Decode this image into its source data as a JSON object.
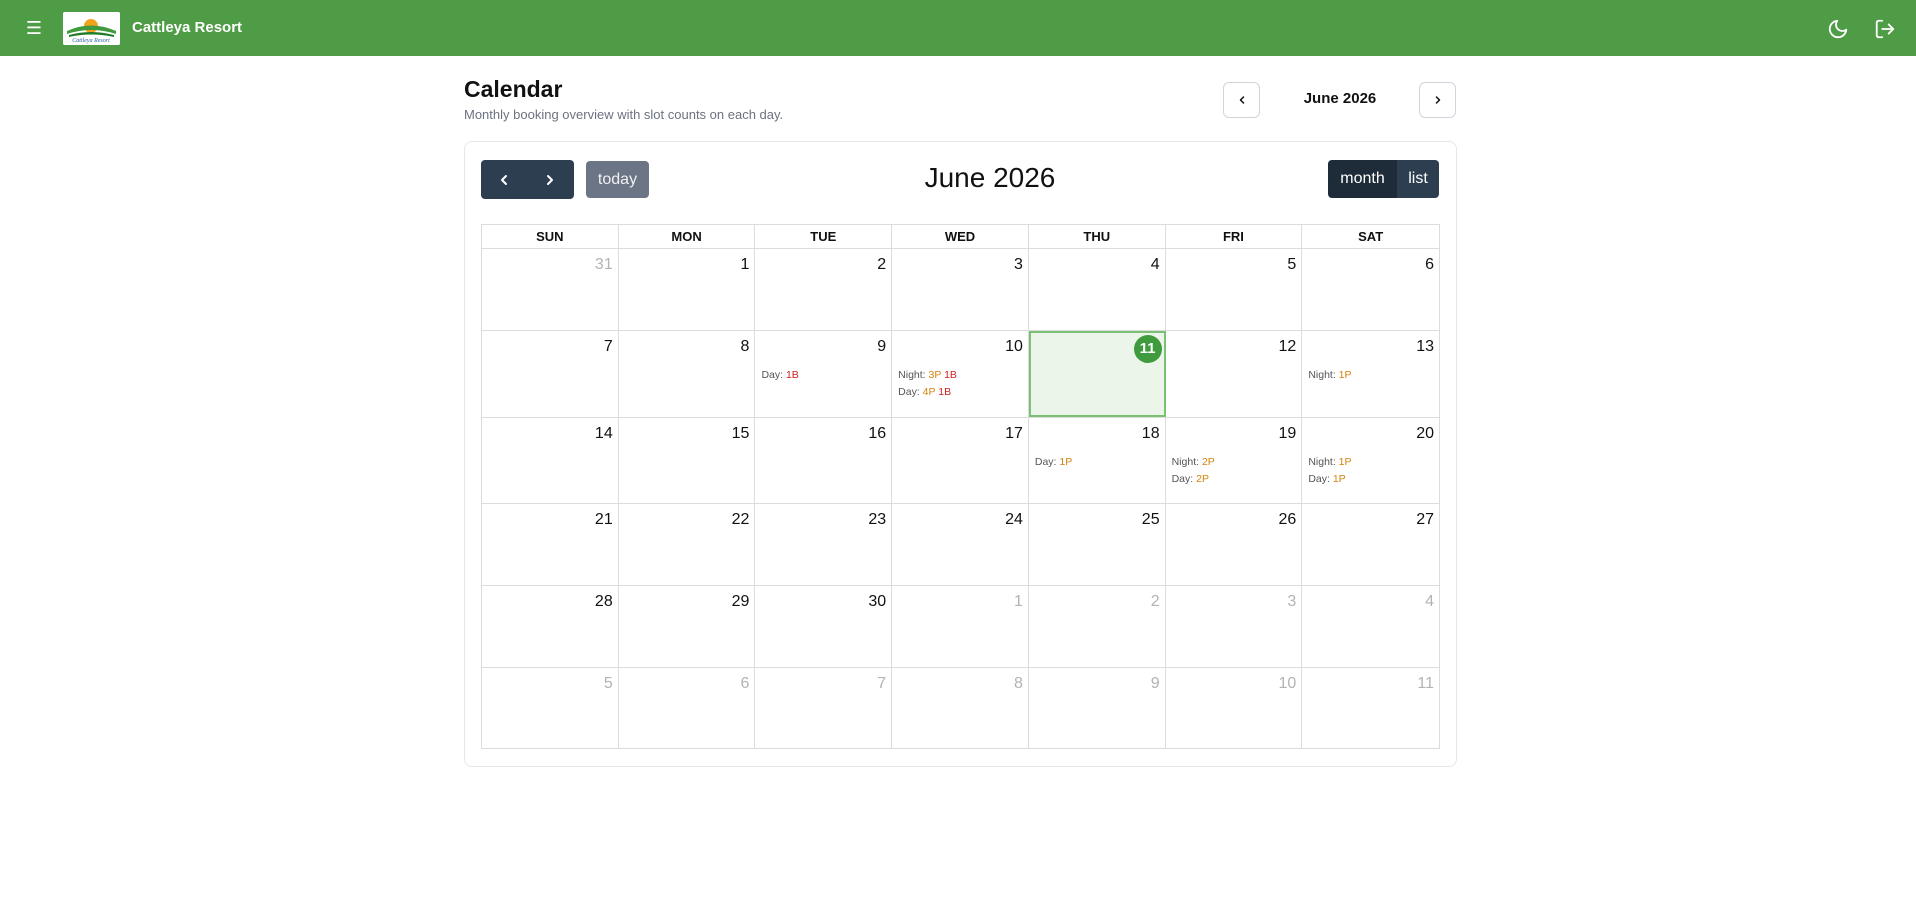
{
  "app": {
    "brand": "Cattleya Resort"
  },
  "header": {
    "title": "Calendar",
    "subtitle": "Monthly booking overview with slot counts on each day.",
    "month_label": "June 2026"
  },
  "calendar": {
    "title": "June 2026",
    "today_label": "today",
    "view_month_label": "month",
    "view_list_label": "list",
    "weekdays": [
      "SUN",
      "MON",
      "TUE",
      "WED",
      "THU",
      "FRI",
      "SAT"
    ],
    "weeks": [
      [
        {
          "num": "31",
          "other": true
        },
        {
          "num": "1"
        },
        {
          "num": "2"
        },
        {
          "num": "3"
        },
        {
          "num": "4"
        },
        {
          "num": "5"
        },
        {
          "num": "6"
        }
      ],
      [
        {
          "num": "7"
        },
        {
          "num": "8"
        },
        {
          "num": "9",
          "slots": [
            {
              "label": "Day:",
              "tags": [
                {
                  "text": "1B",
                  "kind": "b"
                }
              ]
            }
          ]
        },
        {
          "num": "10",
          "slots": [
            {
              "label": "Night:",
              "tags": [
                {
                  "text": "3P",
                  "kind": "p"
                },
                {
                  "text": "1B",
                  "kind": "b"
                }
              ]
            },
            {
              "label": "Day:",
              "tags": [
                {
                  "text": "4P",
                  "kind": "p"
                },
                {
                  "text": "1B",
                  "kind": "b"
                }
              ]
            }
          ]
        },
        {
          "num": "11",
          "today": true
        },
        {
          "num": "12"
        },
        {
          "num": "13",
          "slots": [
            {
              "label": "Night:",
              "tags": [
                {
                  "text": "1P",
                  "kind": "p"
                }
              ]
            }
          ]
        }
      ],
      [
        {
          "num": "14"
        },
        {
          "num": "15"
        },
        {
          "num": "16"
        },
        {
          "num": "17"
        },
        {
          "num": "18",
          "slots": [
            {
              "label": "Day:",
              "tags": [
                {
                  "text": "1P",
                  "kind": "p"
                }
              ]
            }
          ]
        },
        {
          "num": "19",
          "slots": [
            {
              "label": "Night:",
              "tags": [
                {
                  "text": "2P",
                  "kind": "p"
                }
              ]
            },
            {
              "label": "Day:",
              "tags": [
                {
                  "text": "2P",
                  "kind": "p"
                }
              ]
            }
          ]
        },
        {
          "num": "20",
          "slots": [
            {
              "label": "Night:",
              "tags": [
                {
                  "text": "1P",
                  "kind": "p"
                }
              ]
            },
            {
              "label": "Day:",
              "tags": [
                {
                  "text": "1P",
                  "kind": "p"
                }
              ]
            }
          ]
        }
      ],
      [
        {
          "num": "21"
        },
        {
          "num": "22"
        },
        {
          "num": "23"
        },
        {
          "num": "24"
        },
        {
          "num": "25"
        },
        {
          "num": "26"
        },
        {
          "num": "27"
        }
      ],
      [
        {
          "num": "28"
        },
        {
          "num": "29"
        },
        {
          "num": "30"
        },
        {
          "num": "1",
          "other": true
        },
        {
          "num": "2",
          "other": true
        },
        {
          "num": "3",
          "other": true
        },
        {
          "num": "4",
          "other": true
        }
      ],
      [
        {
          "num": "5",
          "other": true
        },
        {
          "num": "6",
          "other": true
        },
        {
          "num": "7",
          "other": true
        },
        {
          "num": "8",
          "other": true
        },
        {
          "num": "9",
          "other": true
        },
        {
          "num": "10",
          "other": true
        },
        {
          "num": "11",
          "other": true
        }
      ]
    ]
  },
  "colors": {
    "topbar": "#4f9c46",
    "today_badge": "#3f9b3d",
    "tag_p": "#d4830b",
    "tag_b": "#d42020",
    "fc_button": "#2c3e50"
  },
  "icons": {
    "menu": "hamburger-icon",
    "theme": "moon-icon",
    "logout": "logout-icon",
    "prev": "chevron-left-icon",
    "next": "chevron-right-icon"
  }
}
